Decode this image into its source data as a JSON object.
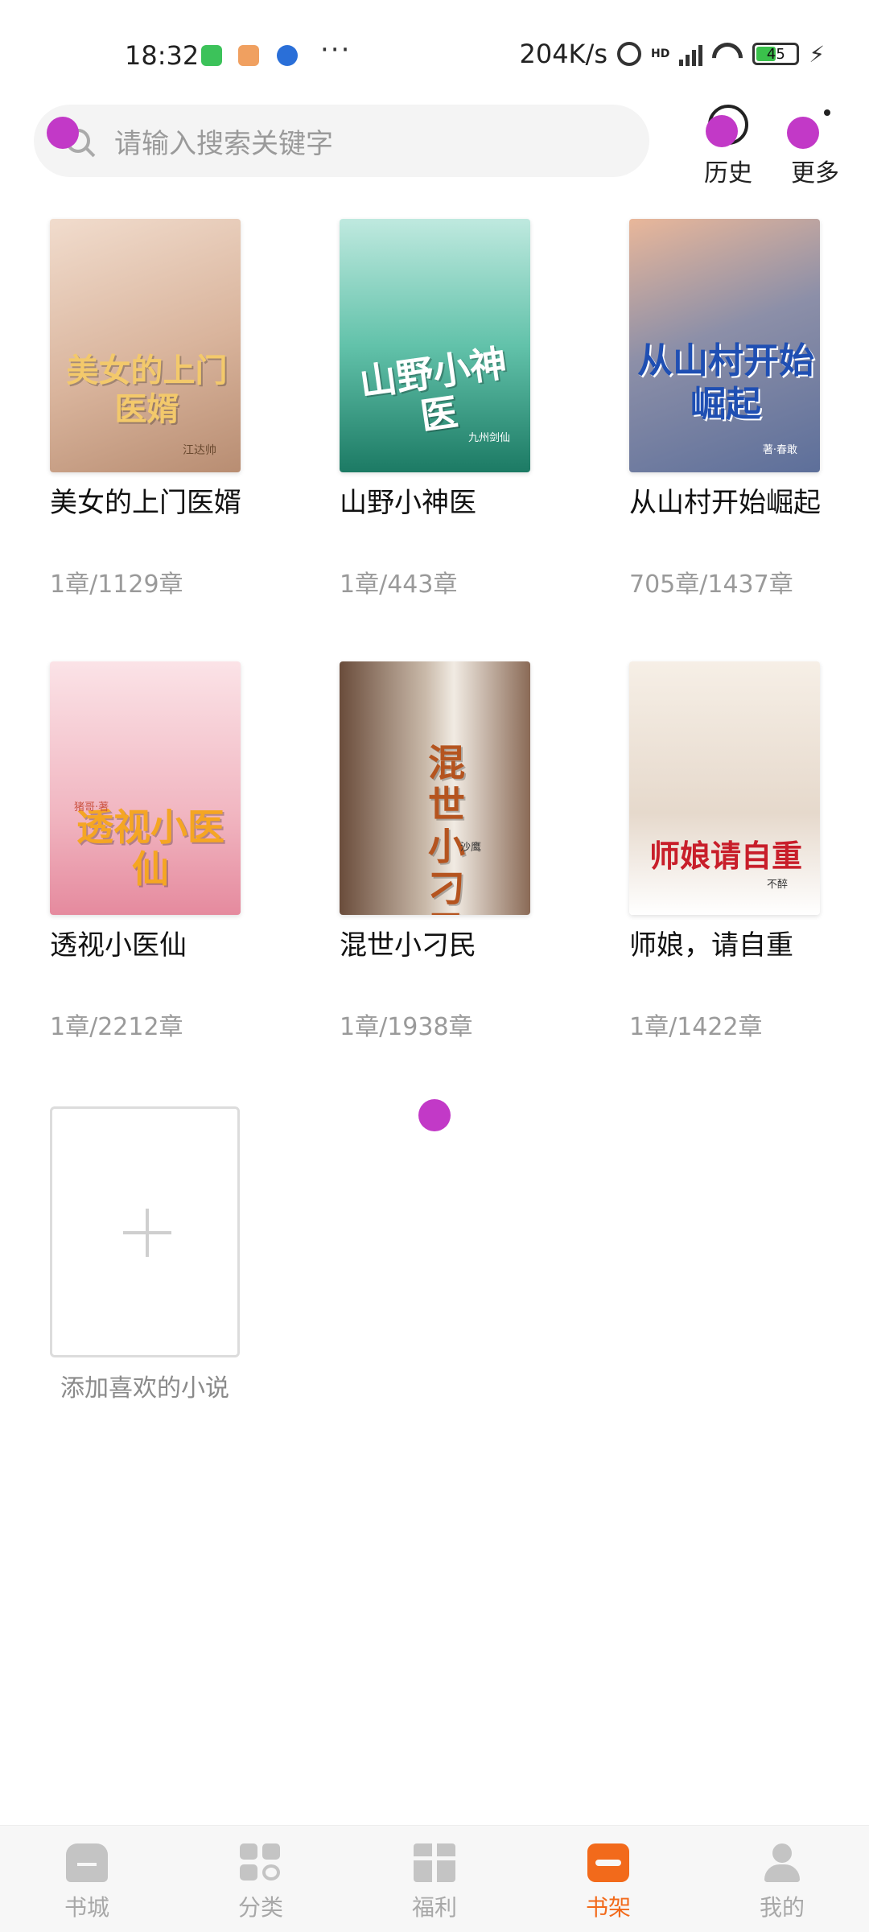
{
  "status_bar": {
    "time": "18:32",
    "network_speed": "204K/s",
    "hd_label": "HD",
    "battery": "45",
    "more": "···",
    "icons": [
      "alarm-icon",
      "signal-icon",
      "wifi-icon",
      "battery-icon",
      "charging-icon"
    ]
  },
  "search": {
    "placeholder": "请输入搜索关键字"
  },
  "header": {
    "history_label": "历史",
    "more_label": "更多"
  },
  "books": [
    {
      "title": "美女的上门医婿",
      "progress": "1章/1129章",
      "cover_text": "美女的上门医婿",
      "cover_author": "江达帅",
      "cover_color": "#d8b9a3"
    },
    {
      "title": "山野小神医",
      "progress": "1章/443章",
      "cover_text": "山野小神医",
      "cover_author": "九州剑仙",
      "cover_color": "#5fbfa8"
    },
    {
      "title": "从山村开始崛起",
      "progress": "705章/1437章",
      "cover_text": "从山村开始崛起",
      "cover_author": "著·春敢",
      "cover_color": "#b98f86"
    },
    {
      "title": "透视小医仙",
      "progress": "1章/2212章",
      "cover_text": "透视小医仙",
      "cover_author": "猪哥·著",
      "cover_color": "#f3c4cc"
    },
    {
      "title": "混世小刁民",
      "progress": "1章/1938章",
      "cover_text": "混世小刁民",
      "cover_author": "沙鹰",
      "cover_color": "#8a6a56"
    },
    {
      "title": "师娘，请自重",
      "progress": "1章/1422章",
      "cover_text": "师娘请自重",
      "cover_author": "不醉",
      "cover_color": "#efe6dc"
    }
  ],
  "add_book": {
    "label": "添加喜欢的小说"
  },
  "bottom_nav": [
    {
      "label": "书城",
      "icon": "bookstore-icon",
      "active": false
    },
    {
      "label": "分类",
      "icon": "category-icon",
      "active": false
    },
    {
      "label": "福利",
      "icon": "gift-icon",
      "active": false
    },
    {
      "label": "书架",
      "icon": "bookshelf-icon",
      "active": true
    },
    {
      "label": "我的",
      "icon": "profile-icon",
      "active": false
    }
  ],
  "colors": {
    "accent": "#f26a1b",
    "muted_text": "#9a9a9a",
    "touch_indicator": "#c239c7"
  }
}
